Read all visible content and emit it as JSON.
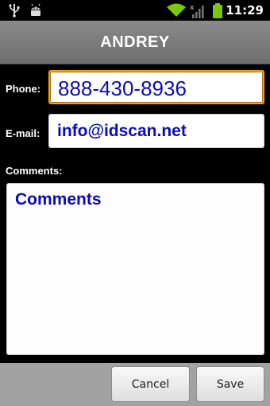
{
  "status_bar": {
    "time": "11:29",
    "icons": [
      "usb-icon",
      "android-debug-icon",
      "wifi-icon",
      "no-signal-icon",
      "battery-icon"
    ]
  },
  "header": {
    "title": "ANDREY"
  },
  "form": {
    "phone_label": "Phone:",
    "phone_value": "888-430-8936",
    "email_label": "E-mail:",
    "email_value": "info@idscan.net",
    "comments_label": "Comments:",
    "comments_placeholder": "Comments"
  },
  "buttons": {
    "cancel_label": "Cancel",
    "save_label": "Save"
  },
  "colors": {
    "focus_border": "#f5a20a",
    "field_text": "#0b0bb8",
    "battery": "#7ac70c",
    "wifi": "#7ac70c"
  }
}
